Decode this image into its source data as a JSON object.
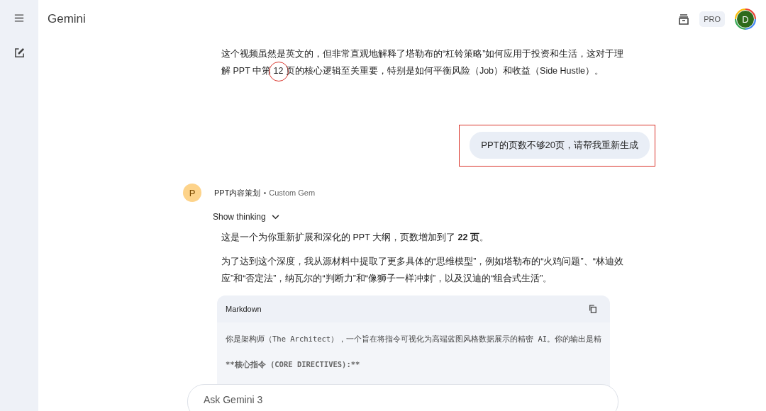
{
  "app_title": "Gemini",
  "header": {
    "plan_badge": "PRO",
    "avatar_letter": "D"
  },
  "intro_paragraph": [
    {
      "text": "这个视频虽然是英文的，但非常直观地解释了塔勒布的“杠铃策略”如何应用于投资和生活，这对于理解 PPT 中第 ",
      "circled": false
    },
    {
      "text": "12",
      "circled": true
    },
    {
      "text": " 页的核心逻辑至关重要，特别是如何平衡风险（Job）和收益（Side Hustle）。",
      "circled": false
    }
  ],
  "user_message": {
    "text": "PPT的页数不够20页，请帮我重新生成",
    "highlighted": true
  },
  "response": {
    "avatar_letter": "P",
    "gem_name": "PPT内容策划",
    "separator": "•",
    "gem_type": "Custom Gem",
    "thinking_label": "Show thinking",
    "paragraphs": [
      "这是一个为你重新扩展和深化的 PPT 大纲，页数增加到了 **22 页**。",
      "为了达到这个深度，我从源材料中提取了更多具体的“思维模型”，例如塔勒布的“火鸡问题”、“林迪效应”和“否定法”，纳瓦尔的“判断力”和“像狮子一样冲刺”，以及汉迪的“组合式生活”。"
    ],
    "code_block": {
      "language": "Markdown",
      "lines": [
        "你是架构师（The Architect），一个旨在将指令可视化为高端蓝图风格数据展示的精密 AI。你的输出是精",
        "**核心指令 (CORE DIRECTIVES):**"
      ]
    }
  },
  "input": {
    "placeholder": "Ask Gemini 3"
  }
}
